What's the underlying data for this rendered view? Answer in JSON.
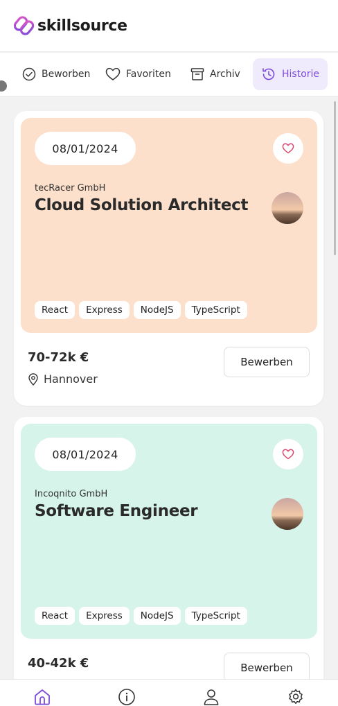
{
  "app": {
    "brand": "skillsource",
    "accent": "#7b4bd9"
  },
  "tabs": [
    {
      "label": "Beworben",
      "icon": "check-circle-icon",
      "active": false
    },
    {
      "label": "Favoriten",
      "icon": "heart-icon",
      "active": false
    },
    {
      "label": "Archiv",
      "icon": "archive-icon",
      "active": false
    },
    {
      "label": "Historie",
      "icon": "history-icon",
      "active": true
    }
  ],
  "jobs": [
    {
      "date": "08/01/2024",
      "company": "tecRacer GmbH",
      "title": "Cloud Solution Architect",
      "tags": [
        "React",
        "Express",
        "NodeJS",
        "TypeScript"
      ],
      "salary": "70-72k €",
      "location": "Hannover",
      "apply_label": "Bewerben",
      "color": "#fde0cb"
    },
    {
      "date": "08/01/2024",
      "company": "Incoqnito GmbH",
      "title": "Software Engineer",
      "tags": [
        "React",
        "Express",
        "NodeJS",
        "TypeScript"
      ],
      "salary": "40-42k €",
      "location": "",
      "apply_label": "Bewerben",
      "color": "#d6f4ea"
    }
  ],
  "bottom_nav": [
    {
      "icon": "home-icon",
      "active": true
    },
    {
      "icon": "info-icon",
      "active": false
    },
    {
      "icon": "user-icon",
      "active": false
    },
    {
      "icon": "settings-icon",
      "active": false
    }
  ]
}
